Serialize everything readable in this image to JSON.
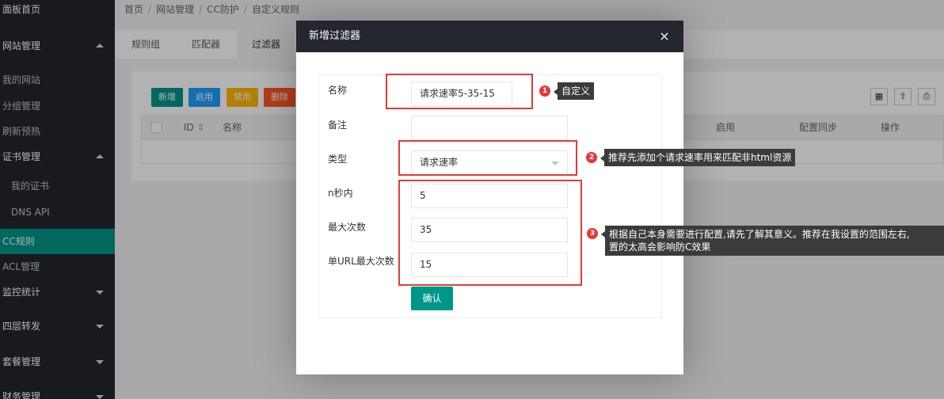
{
  "sidebar": {
    "items": [
      {
        "label": "面板首页"
      },
      {
        "label": "网站管理"
      },
      {
        "label": "我的网站"
      },
      {
        "label": "分组管理"
      },
      {
        "label": "刷新预热"
      },
      {
        "label": "证书管理"
      },
      {
        "label": "我的证书"
      },
      {
        "label": "DNS API"
      },
      {
        "label": "CC规则"
      },
      {
        "label": "ACL管理"
      },
      {
        "label": "监控统计"
      },
      {
        "label": "四层转发"
      },
      {
        "label": "套餐管理"
      },
      {
        "label": "财务管理"
      }
    ]
  },
  "breadcrumb": [
    "首页",
    "网站管理",
    "CC防护",
    "自定义规则"
  ],
  "tabs": [
    {
      "label": "规则组"
    },
    {
      "label": "匹配器"
    },
    {
      "label": "过滤器"
    }
  ],
  "toolbar": {
    "add": "新增",
    "enable": "启用",
    "disable": "禁用",
    "delete": "删除"
  },
  "table": {
    "headers": [
      "ID",
      "名称",
      "启用",
      "配置同步",
      "操作"
    ]
  },
  "modal": {
    "title": "新增过滤器",
    "close": "×",
    "fields": {
      "name_label": "名称",
      "name_value": "请求速率5-35-15",
      "remark_label": "备注",
      "remark_value": "",
      "type_label": "类型",
      "type_value": "请求速率",
      "n_seconds_label": "n秒内",
      "n_seconds_value": "5",
      "max_count_label": "最大次数",
      "max_count_value": "35",
      "url_max_label": "单URL最大次数",
      "url_max_value": "15"
    },
    "confirm": "确认"
  },
  "annotations": [
    {
      "num": "1",
      "text": "自定义"
    },
    {
      "num": "2",
      "text": "推荐先添加个请求速率用来匹配非html资源"
    },
    {
      "num": "3",
      "line1": "根据自己本身需要进行配置,请先了解其意义。推荐在我设置的范围左右,",
      "line2": "置的太高会影响防C效果"
    }
  ],
  "colors": {
    "sidebar_bg": "#23262e",
    "accent": "#009688",
    "annotation_red": "#e53935"
  }
}
